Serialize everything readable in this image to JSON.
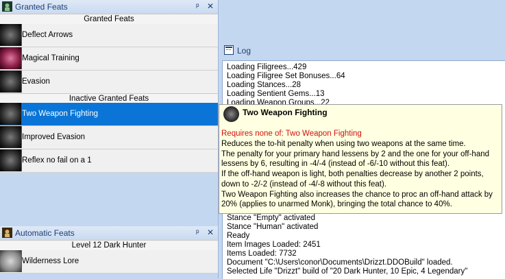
{
  "granted_panel": {
    "title": "Granted Feats",
    "pin_glyph": "ᵖ",
    "close_glyph": "✕",
    "header_granted": "Granted Feats",
    "header_inactive": "Inactive Granted Feats",
    "granted": [
      {
        "label": "Deflect Arrows",
        "icon": "deflect-arrows-icon"
      },
      {
        "label": "Magical Training",
        "icon": "magical-training-icon"
      },
      {
        "label": "Evasion",
        "icon": "evasion-icon"
      }
    ],
    "inactive": [
      {
        "label": "Two Weapon Fighting",
        "icon": "two-weapon-fighting-icon",
        "selected": true
      },
      {
        "label": "Improved Evasion",
        "icon": "improved-evasion-icon"
      },
      {
        "label": "Reflex no fail on a 1",
        "icon": "reflex-icon"
      }
    ]
  },
  "automatic_panel": {
    "title": "Automatic Feats",
    "header": "Level 12 Dark Hunter",
    "items": [
      {
        "label": "Wilderness Lore",
        "icon": "wilderness-lore-icon"
      }
    ]
  },
  "log_panel": {
    "title": "Log",
    "lines_top": [
      "Loading Filigrees...429",
      "Loading Filigree Set Bonuses...64",
      "Loading Stances...28",
      "Loading Sentient Gems...13",
      "Loading Weapon Groups...22"
    ],
    "lines_bottom": [
      "Stance \"Empty\" activated",
      "Stance \"Human\" activated",
      "Ready",
      "Item Images Loaded: 2451",
      "Items Loaded: 7732",
      "Document \"C:\\Users\\conor\\Documents\\Drizzt.DDOBuild\" loaded.",
      "Selected Life \"Drizzt\" build of \"20 Dark Hunter, 10 Epic, 4 Legendary\""
    ]
  },
  "tooltip": {
    "title": "Two Weapon Fighting",
    "requirement": "Requires none of: Two Weapon Fighting",
    "description": [
      "Reduces the to-hit penalty when using two weapons at the same time.",
      "The penalty for your primary hand lessens by 2 and the one for your off-hand lessens by 6, resulting in -4/-4 (instead of -6/-10 without this feat).",
      "If the off-hand weapon is light, both penalties decrease by another 2 points, down to -2/-2 (instead of -4/-8 without this feat).",
      "Two Weapon Fighting also increases the chance to proc an off-hand attack by 20% (applies to unarmed Monk), bringing the total chance to 40%."
    ]
  },
  "colors": {
    "accent": "#0a75d6",
    "tooltip_bg": "#ffffe1",
    "requirement_text": "#d01010",
    "frame_bg": "#c4d7f0"
  }
}
